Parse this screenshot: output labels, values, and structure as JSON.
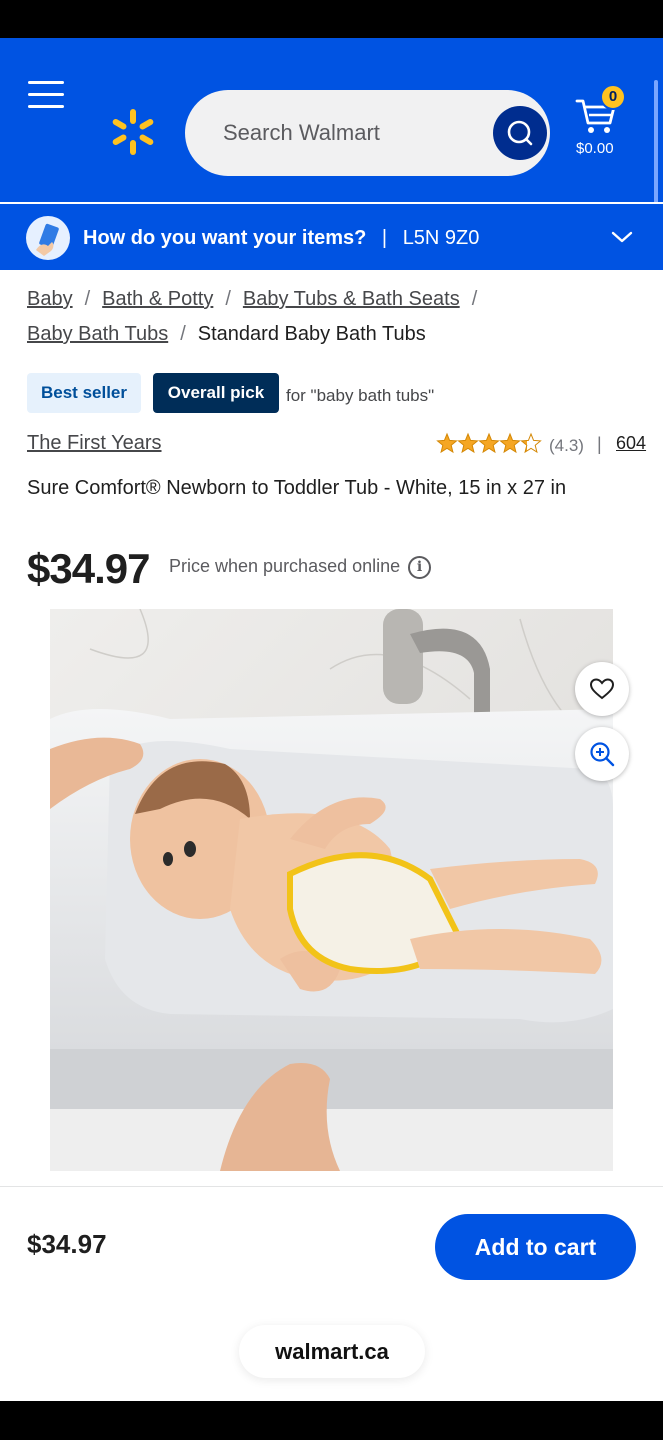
{
  "colors": {
    "brand_blue": "#0053e2",
    "spark_yellow": "#ffc220",
    "dark_navy": "#002d58",
    "star": "#f5a623"
  },
  "header": {
    "menu_icon": "hamburger-menu-icon",
    "logo_icon": "walmart-spark-icon",
    "search": {
      "placeholder": "Search Walmart",
      "icon": "search-icon"
    },
    "cart": {
      "icon": "cart-icon",
      "count": "0",
      "total": "$0.00"
    }
  },
  "delivery": {
    "question": "How do you want your items?",
    "separator": "|",
    "postal_code": "L5N 9Z0",
    "icon": "chevron-down-icon"
  },
  "breadcrumbs": {
    "items": [
      "Baby",
      "Bath & Potty",
      "Baby Tubs & Bath Seats",
      "Baby Bath Tubs"
    ],
    "separator": "/",
    "current": "Standard Baby Bath Tubs"
  },
  "badges": {
    "best_seller": "Best seller",
    "overall_pick": "Overall pick",
    "for_text": "for \"baby bath tubs\""
  },
  "product": {
    "brand": "The First Years",
    "rating": 4.3,
    "rating_text": "(4.3)",
    "rating_separator": "|",
    "review_count": "604",
    "title": "Sure Comfort® Newborn to Toddler Tub - White, 15 in x 27 in",
    "price": "$34.97",
    "price_note": "Price when purchased online",
    "info_icon": "i"
  },
  "image_actions": {
    "favorite_icon": "heart-icon",
    "zoom_icon": "zoom-in-icon"
  },
  "footer": {
    "price": "$34.97",
    "add_to_cart": "Add to cart"
  },
  "browser": {
    "url": "walmart.ca"
  }
}
